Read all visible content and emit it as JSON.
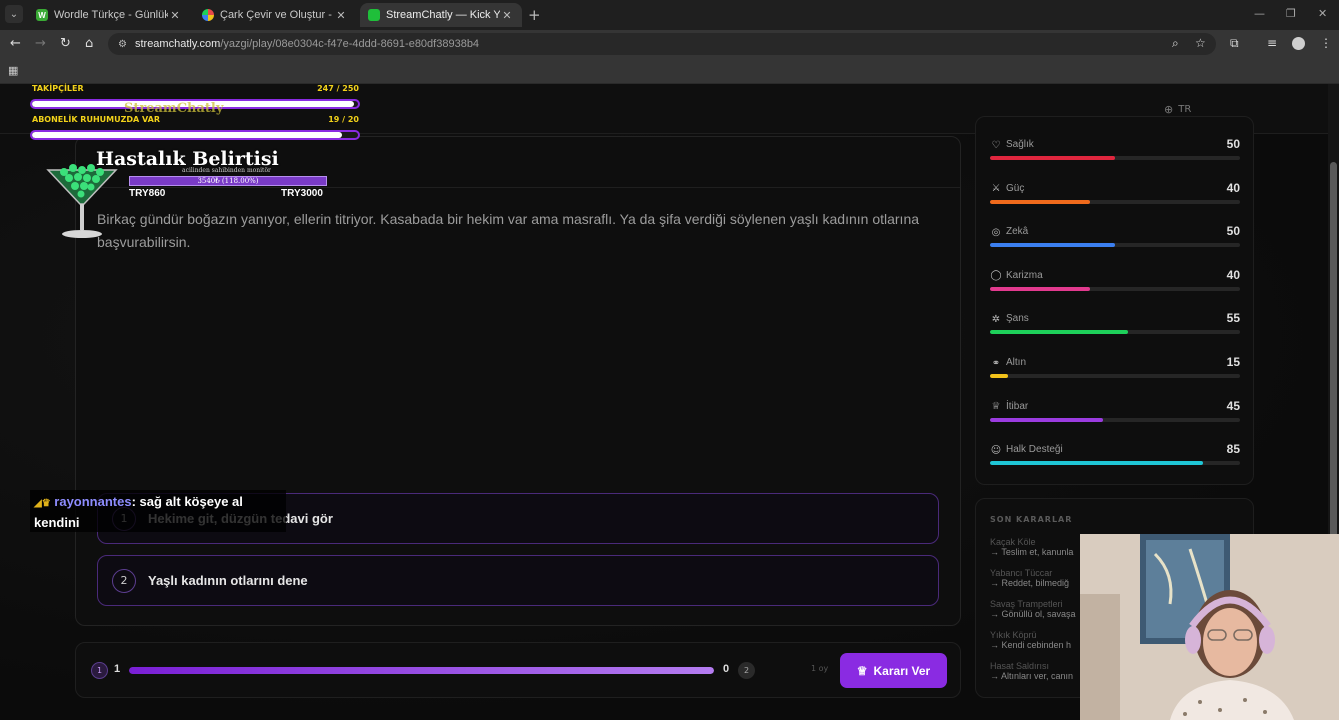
{
  "browser": {
    "tabs": [
      {
        "title": "Wordle Türkçe - Günlük Kelime",
        "favicon": "W",
        "favicon_color": "#3aaa35"
      },
      {
        "title": "Çark Çevir ve Oluştur - Ücretsiz",
        "favicon": "",
        "favicon_color": "#e84a4a"
      },
      {
        "title": "StreamChatly — Kick Yayıncıları",
        "favicon": "",
        "favicon_color": "#1fbf3a"
      }
    ],
    "url_host": "streamchatly.com",
    "url_path": "/yazgi/play/08e0304c-f47e-4ddd-8691-e80df38938b4"
  },
  "header": {
    "lang": "TR"
  },
  "story": {
    "text": "Birkaç gündür boğazın yanıyor, ellerin titriyor. Kasabada bir hekim var ama masraflı. Ya da şifa verdiği söylenen yaşlı kadının otlarına başvurabilirsin.",
    "choices": [
      {
        "num": "1",
        "label": "Hekime git, düzgün tedavi gör"
      },
      {
        "num": "2",
        "label": "Yaşlı kadının otlarını dene"
      }
    ]
  },
  "vote": {
    "left_badge": "1",
    "left_count": "1",
    "right_count": "0",
    "right_badge": "2",
    "share_left": 1.0,
    "timer": "1 oy",
    "decide_label": "Kararı Ver"
  },
  "stats": [
    {
      "icon": "heart-icon",
      "glyph": "♡",
      "name": "Sağlık",
      "value": "50",
      "pct": 50,
      "color": "#e0263e"
    },
    {
      "icon": "sword-icon",
      "glyph": "⚔",
      "name": "Güç",
      "value": "40",
      "pct": 40,
      "color": "#f06a1c"
    },
    {
      "icon": "brain-icon",
      "glyph": "◎",
      "name": "Zekâ",
      "value": "50",
      "pct": 50,
      "color": "#3b7ff0"
    },
    {
      "icon": "chat-bubble-icon",
      "glyph": "◯",
      "name": "Karizma",
      "value": "40",
      "pct": 40,
      "color": "#e23a8e"
    },
    {
      "icon": "clover-icon",
      "glyph": "✲",
      "name": "Şans",
      "value": "55",
      "pct": 55,
      "color": "#1ed05a"
    },
    {
      "icon": "coins-icon",
      "glyph": "⚭",
      "name": "Altın",
      "value": "15",
      "pct": 7,
      "color": "#f2c21a"
    },
    {
      "icon": "crown-icon",
      "glyph": "♕",
      "name": "İtibar",
      "value": "45",
      "pct": 45,
      "color": "#9b3ce0"
    },
    {
      "icon": "people-icon",
      "glyph": "☺",
      "name": "Halk Desteği",
      "value": "85",
      "pct": 85,
      "color": "#1fc6d6"
    }
  ],
  "decisions": {
    "heading": "SON KARARLAR",
    "items": [
      {
        "event": "Kaçak Köle",
        "choice": "→ Teslim et, kanunla"
      },
      {
        "event": "Yabancı Tüccar",
        "choice": "→ Reddet, bilmediğ"
      },
      {
        "event": "Savaş Trampetleri",
        "choice": "→ Gönüllü ol, savaşa"
      },
      {
        "event": "Yıkık Köprü",
        "choice": "→ Kendi cebinden h"
      },
      {
        "event": "Hasat Saldırısı",
        "choice": "→ Altınları ver, canın"
      }
    ]
  },
  "overlay": {
    "followers_label": "TAKİPÇİLER",
    "followers_value": "247 / 250",
    "followers_frac": 0.988,
    "subs_label": "ABONELİK RUHUMUZDA VAR",
    "subs_value": "19 / 20",
    "subs_frac": 0.95,
    "watermark": "StreamChatly",
    "goal_title": "Hastalık Belirtisi",
    "goal_subtitle": "acilinden sahibinden monitör",
    "goal_progress": "3540₺ (118.00%)",
    "goal_min": "TRY860",
    "goal_max": "TRY3000",
    "chat_badges": "◢♛",
    "chat_user": "rayonnantes",
    "chat_text": ": sağ alt köşeye al kendini"
  }
}
